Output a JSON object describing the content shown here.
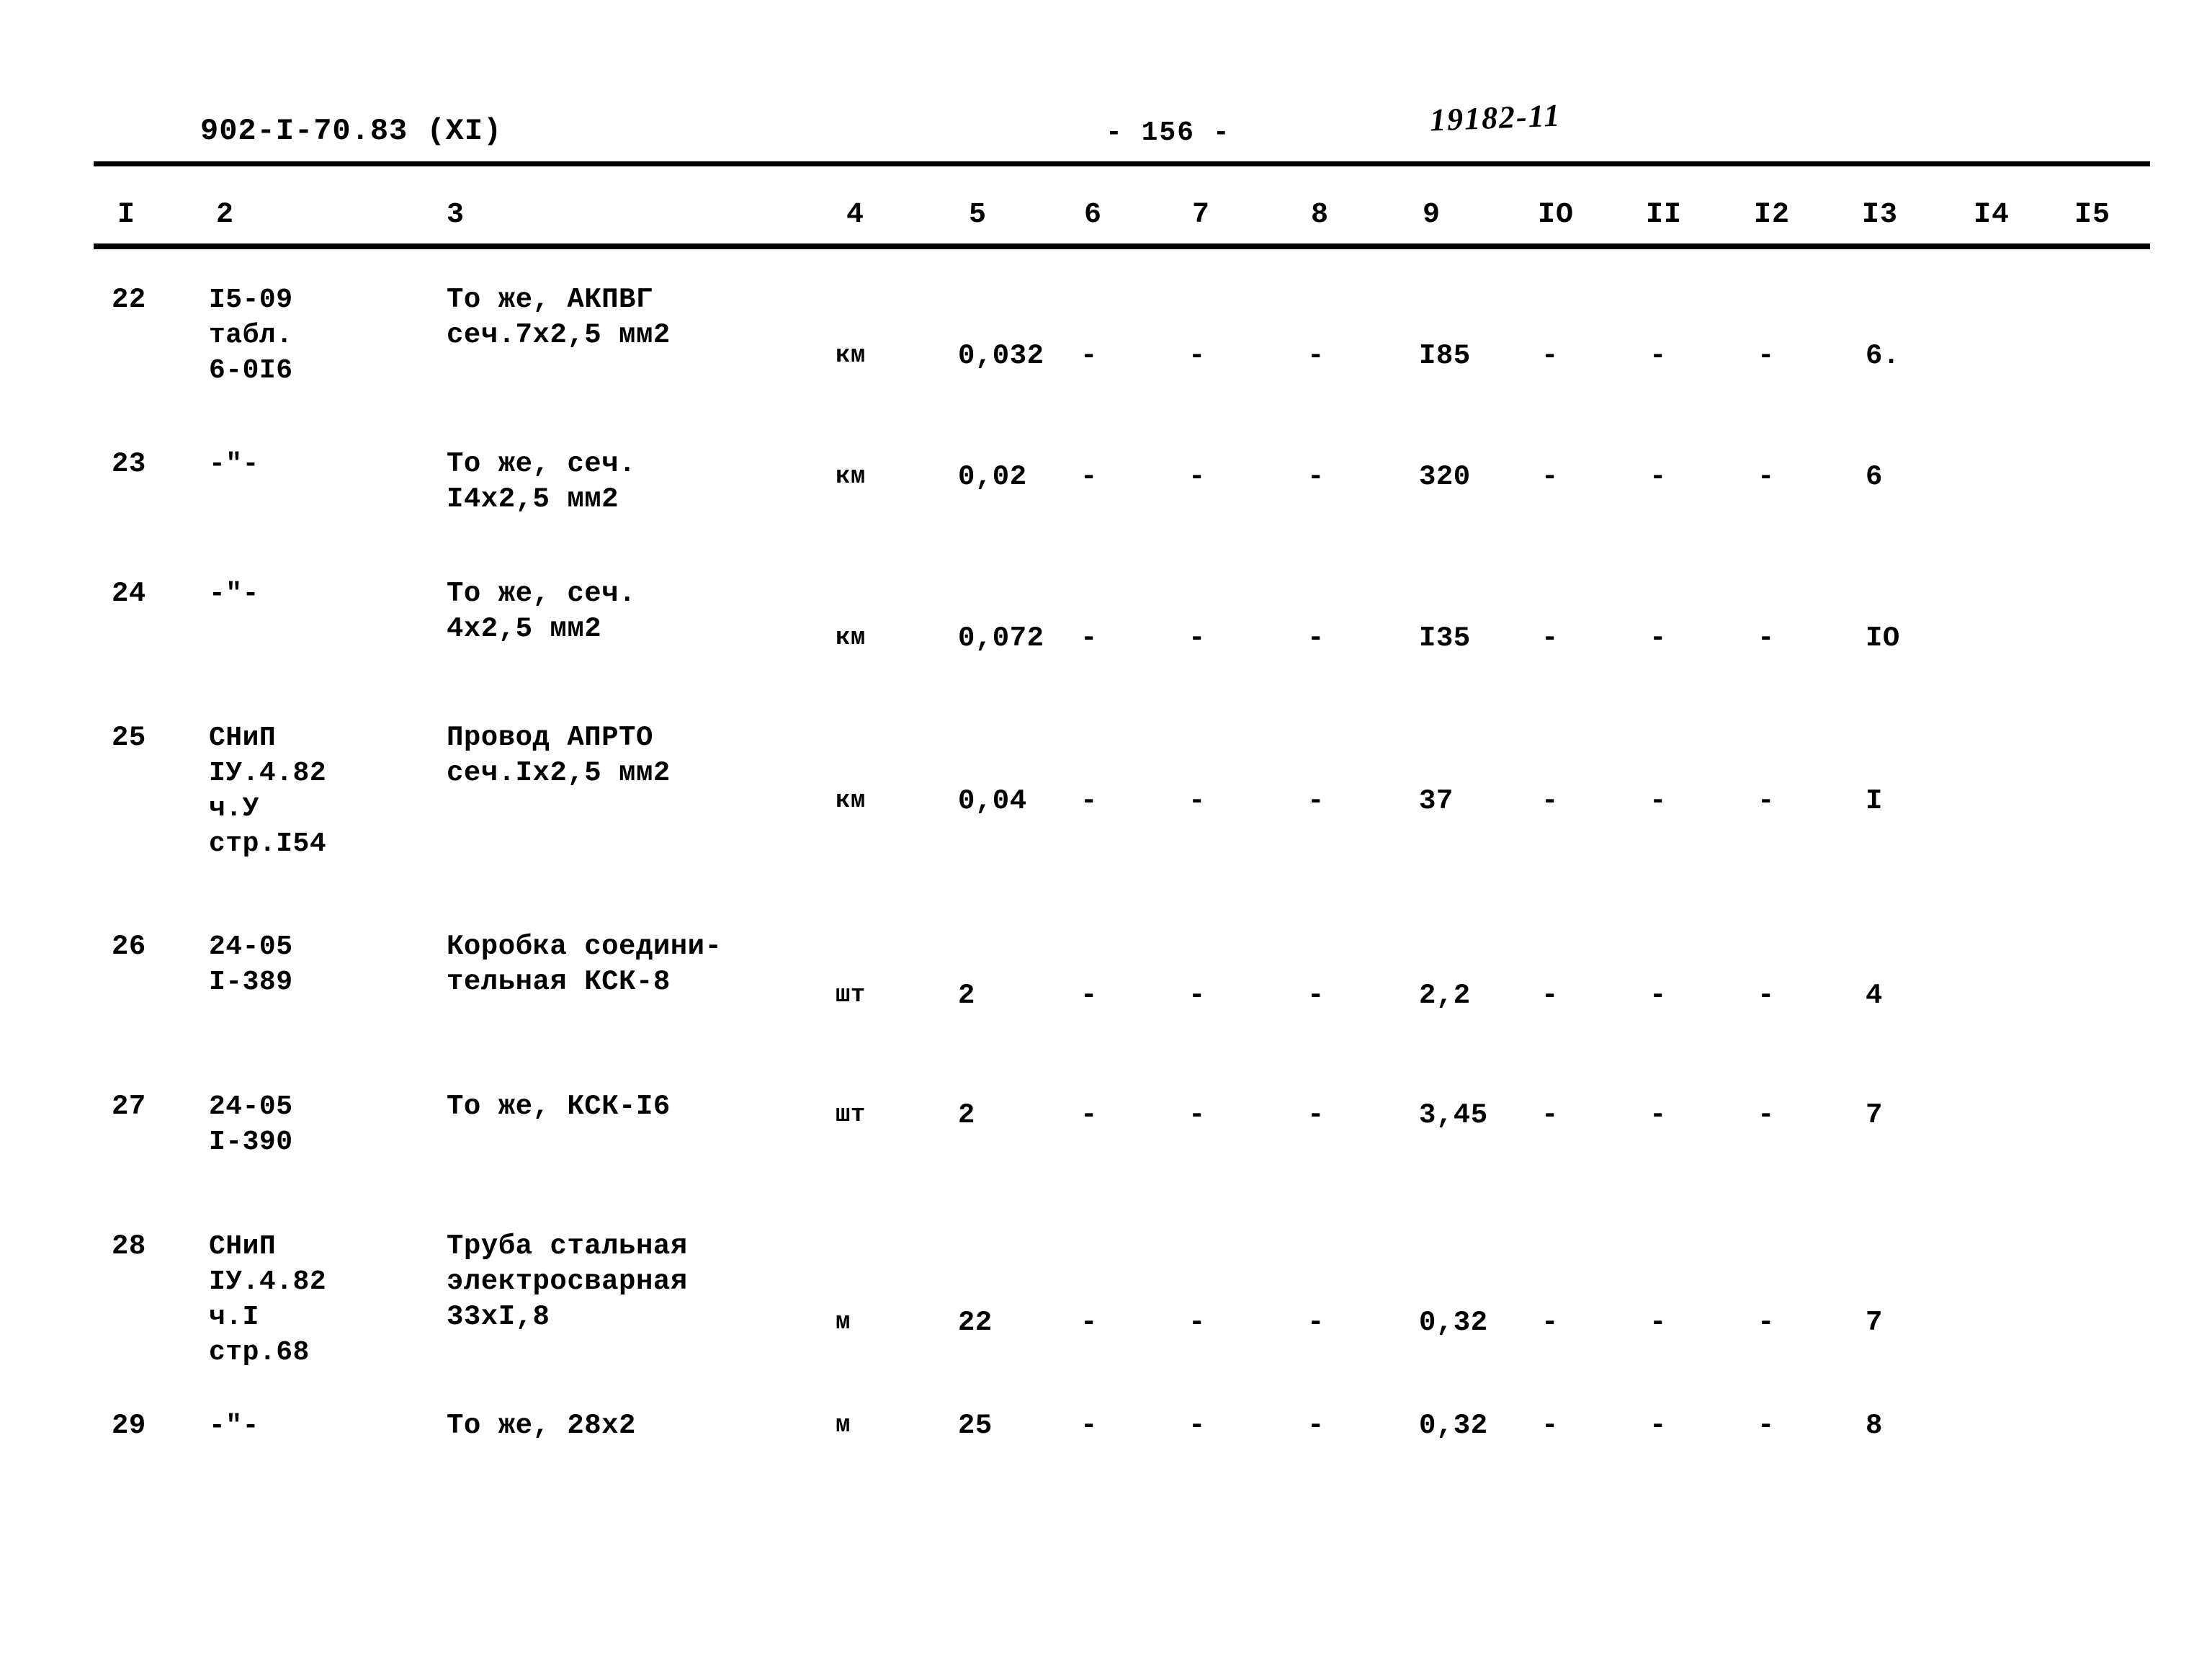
{
  "header": {
    "doc_code": "902-I-70.83  (XI)",
    "page_number": "- 156 -",
    "archive_mark": "19182-11"
  },
  "table": {
    "column_headers": [
      "I",
      "2",
      "3",
      "4",
      "5",
      "6",
      "7",
      "8",
      "9",
      "IO",
      "II",
      "I2",
      "I3",
      "I4",
      "I5"
    ],
    "rows": [
      {
        "c1": "22",
        "c2": "I5-09\nтабл.\n6-0I6",
        "c3": "То же, АКПВГ\nсеч.7х2,5 мм2",
        "c4": "км",
        "c5": "0,032",
        "c6": "-",
        "c7": "-",
        "c8": "-",
        "c9": "I85",
        "c10": "-",
        "c11": "-",
        "c12": "-",
        "c13": "6.",
        "c14": "",
        "c15": ""
      },
      {
        "c1": "23",
        "c2": "-\"-",
        "c3": "То же, сеч.\nI4х2,5 мм2",
        "c4": "км",
        "c5": "0,02",
        "c6": "-",
        "c7": "-",
        "c8": "-",
        "c9": "320",
        "c10": "-",
        "c11": "-",
        "c12": "-",
        "c13": "6",
        "c14": "",
        "c15": ""
      },
      {
        "c1": "24",
        "c2": "-\"-",
        "c3": "То же, сеч.\n4х2,5 мм2",
        "c4": "км",
        "c5": "0,072",
        "c6": "-",
        "c7": "-",
        "c8": "-",
        "c9": "I35",
        "c10": "-",
        "c11": "-",
        "c12": "-",
        "c13": "IO",
        "c14": "",
        "c15": ""
      },
      {
        "c1": "25",
        "c2": "СНиП\nIУ.4.82\nч.У\nстр.I54",
        "c3": "Провод АПРТО\nсеч.Iх2,5 мм2",
        "c4": "км",
        "c5": "0,04",
        "c6": "-",
        "c7": "-",
        "c8": "-",
        "c9": "37",
        "c10": "-",
        "c11": "-",
        "c12": "-",
        "c13": "I",
        "c14": "",
        "c15": ""
      },
      {
        "c1": "26",
        "c2": "24-05\nI-389",
        "c3": "Коробка соедини-\nтельная КСК-8",
        "c4": "шт",
        "c5": "2",
        "c6": "-",
        "c7": "-",
        "c8": "-",
        "c9": "2,2",
        "c10": "-",
        "c11": "-",
        "c12": "-",
        "c13": "4",
        "c14": "",
        "c15": ""
      },
      {
        "c1": "27",
        "c2": "24-05\nI-390",
        "c3": "То же, КСК-I6",
        "c4": "шт",
        "c5": "2",
        "c6": "-",
        "c7": "-",
        "c8": "-",
        "c9": "3,45",
        "c10": "-",
        "c11": "-",
        "c12": "-",
        "c13": "7",
        "c14": "",
        "c15": ""
      },
      {
        "c1": "28",
        "c2": "СНиП\nIУ.4.82\nч.I\nстр.68",
        "c3": "Труба стальная\nэлектросварная\n33хI,8",
        "c4": "м",
        "c5": "22",
        "c6": "-",
        "c7": "-",
        "c8": "-",
        "c9": "0,32",
        "c10": "-",
        "c11": "-",
        "c12": "-",
        "c13": "7",
        "c14": "",
        "c15": ""
      },
      {
        "c1": "29",
        "c2": "-\"-",
        "c3": "То же, 28х2",
        "c4": "м",
        "c5": "25",
        "c6": "-",
        "c7": "-",
        "c8": "-",
        "c9": "0,32",
        "c10": "-",
        "c11": "-",
        "c12": "-",
        "c13": "8",
        "c14": "",
        "c15": ""
      }
    ]
  }
}
